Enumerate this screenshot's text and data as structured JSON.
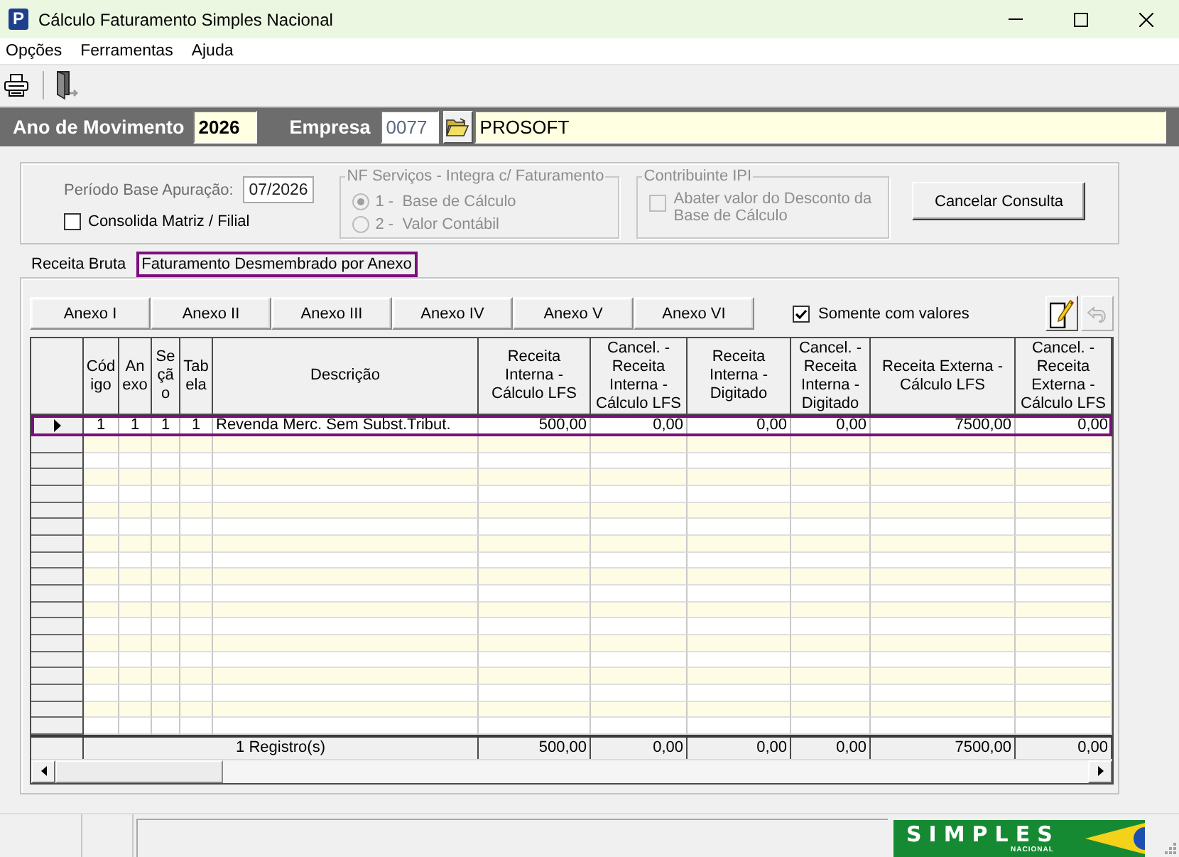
{
  "window": {
    "title": "Cálculo Faturamento Simples Nacional",
    "icon_letter": "P"
  },
  "menu": [
    "Opções",
    "Ferramentas",
    "Ajuda"
  ],
  "header": {
    "year_label": "Ano de Movimento",
    "year": "2026",
    "company_label": "Empresa",
    "company_code": "0077",
    "company_name": "PROSOFT"
  },
  "filters": {
    "period": {
      "label": "Período Base Apuração:",
      "value": "07/2026",
      "disabled": true
    },
    "consolidate": {
      "label": "Consolida Matriz / Filial",
      "checked": false
    },
    "nf_group": {
      "title": "NF Serviços - Integra c/ Faturamento",
      "disabled": true,
      "options": [
        {
          "label": "1 -  Base de Cálculo",
          "selected": true
        },
        {
          "label": "2 -  Valor Contábil",
          "selected": false
        }
      ]
    },
    "ipi_group": {
      "title": "Contribuinte IPI",
      "disabled": true,
      "checkbox": {
        "label": "Abater valor do Desconto da Base de Cálculo",
        "checked": false
      }
    },
    "cancel_button": "Cancelar Consulta"
  },
  "tabs": [
    {
      "label": "Receita Bruta",
      "selected": false
    },
    {
      "label": "Faturamento Desmembrado por Anexo",
      "selected": true
    }
  ],
  "annex_tabs": [
    "Anexo I",
    "Anexo II",
    "Anexo III",
    "Anexo IV",
    "Anexo V",
    "Anexo VI"
  ],
  "only_with_values": {
    "label": "Somente com valores",
    "checked": true
  },
  "undo_button": {
    "disabled": true
  },
  "table": {
    "columns": [
      {
        "label": "Código",
        "kind": "code"
      },
      {
        "label": "Anexo",
        "kind": "code"
      },
      {
        "label": "Seção",
        "kind": "code"
      },
      {
        "label": "Tabela",
        "kind": "code"
      },
      {
        "label": "Descrição",
        "kind": "text"
      },
      {
        "label": "Receita Interna - Cálculo LFS",
        "kind": "number"
      },
      {
        "label": "Cancel. - Receita Interna - Cálculo LFS",
        "kind": "number"
      },
      {
        "label": "Receita Interna - Digitado",
        "kind": "number"
      },
      {
        "label": "Cancel. - Receita Interna - Digitado",
        "kind": "number"
      },
      {
        "label": "Receita Externa - Cálculo LFS",
        "kind": "number"
      },
      {
        "label": "Cancel. - Receita Externa - Cálculo LFS",
        "kind": "number"
      }
    ],
    "rows": [
      {
        "selected": true,
        "cells": [
          "1",
          "1",
          "1",
          "1",
          "Revenda Merc. Sem Subst.Tribut.",
          "500,00",
          "0,00",
          "0,00",
          "0,00",
          "7500,00",
          "0,00"
        ]
      }
    ],
    "footer": {
      "label": "1 Registro(s)",
      "totals": [
        "500,00",
        "0,00",
        "0,00",
        "0,00",
        "7500,00",
        "0,00"
      ]
    }
  },
  "status_bar": {
    "logo_text": "SIMPLES",
    "logo_subtext": "NACIONAL"
  }
}
